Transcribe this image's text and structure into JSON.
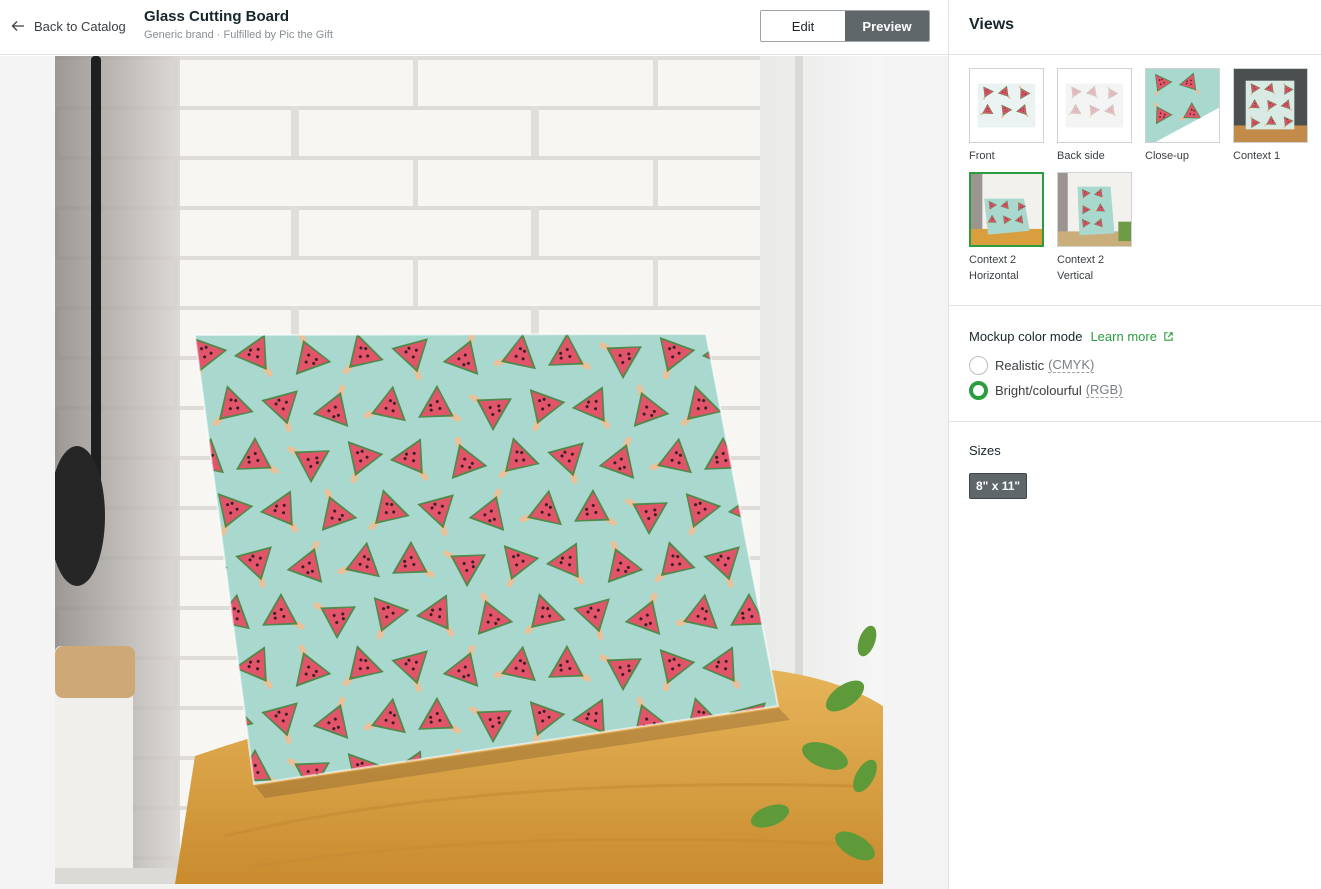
{
  "header": {
    "back_label": "Back to Catalog",
    "title": "Glass Cutting Board",
    "subtitle": "Generic brand · Fulfilled by Pic the Gift",
    "edit_label": "Edit",
    "preview_label": "Preview",
    "active_tab": "Preview"
  },
  "panel": {
    "views_title": "Views",
    "views": [
      {
        "label": "Front",
        "label2": "",
        "selected": false
      },
      {
        "label": "Back side",
        "label2": "",
        "selected": false
      },
      {
        "label": "Close-up",
        "label2": "",
        "selected": false
      },
      {
        "label": "Context 1",
        "label2": "",
        "selected": false
      },
      {
        "label": "Context 2",
        "label2": "Horizontal",
        "selected": true
      },
      {
        "label": "Context 2",
        "label2": "Vertical",
        "selected": false
      }
    ],
    "color_mode": {
      "title": "Mockup color mode",
      "learn_more": "Learn more",
      "options": [
        {
          "label": "Realistic",
          "tag": "(CMYK)",
          "selected": false
        },
        {
          "label": "Bright/colourful",
          "tag": "(RGB)",
          "selected": true
        }
      ]
    },
    "sizes": {
      "title": "Sizes",
      "options": [
        "8\" x 11\""
      ],
      "selected": "8\" x 11\""
    }
  },
  "colors": {
    "accent": "#2a9d3f",
    "dark_button": "#5f676b",
    "board_bg": "#a9d8cf",
    "melon": "#e2546a",
    "rind": "#4f8a4b",
    "towel": "#e0a94a",
    "brick": "#f5f4f1"
  }
}
